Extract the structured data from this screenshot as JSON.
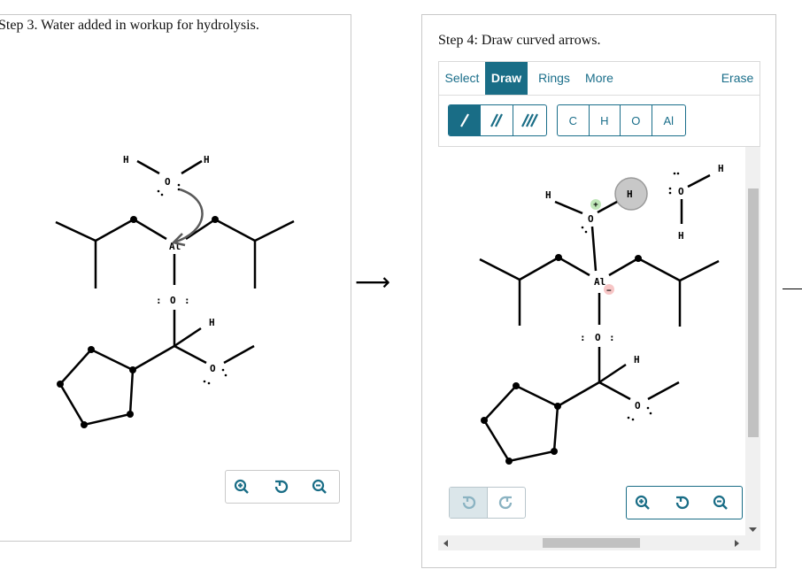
{
  "left_panel": {
    "title": "Step 3. Water added in workup for hydrolysis."
  },
  "right_panel": {
    "title": "Step 4: Draw curved arrows.",
    "tabs": [
      "Select",
      "Draw",
      "Rings",
      "More"
    ],
    "active_tab": "Draw",
    "erase_label": "Erase",
    "bond_buttons": [
      {
        "name": "single-bond-icon",
        "active": true
      },
      {
        "name": "double-bond-icon",
        "active": false
      },
      {
        "name": "triple-bond-icon",
        "active": false
      }
    ],
    "atom_buttons": [
      "C",
      "H",
      "O",
      "Al"
    ]
  },
  "arrow_glyph": "⟶",
  "colors": {
    "accent": "#196d86",
    "plus_charge": "#bfe6b8",
    "minus_charge": "#f7c6c6",
    "selection": "#c8c8c8",
    "curved_arrow": "#5a5a5a"
  },
  "molecule_left": {
    "atoms": [
      "H",
      "O",
      "H",
      "Al",
      "O",
      "H",
      "O"
    ],
    "lone_pair_marks": [
      ":",
      ":"
    ]
  },
  "molecule_right": {
    "atoms": [
      "H",
      "O",
      "H",
      "Al",
      "O",
      "H",
      "O",
      "O",
      "H",
      "H"
    ],
    "charges": [
      "+",
      "−"
    ],
    "lone_pair_marks": [
      ":",
      ":"
    ]
  }
}
